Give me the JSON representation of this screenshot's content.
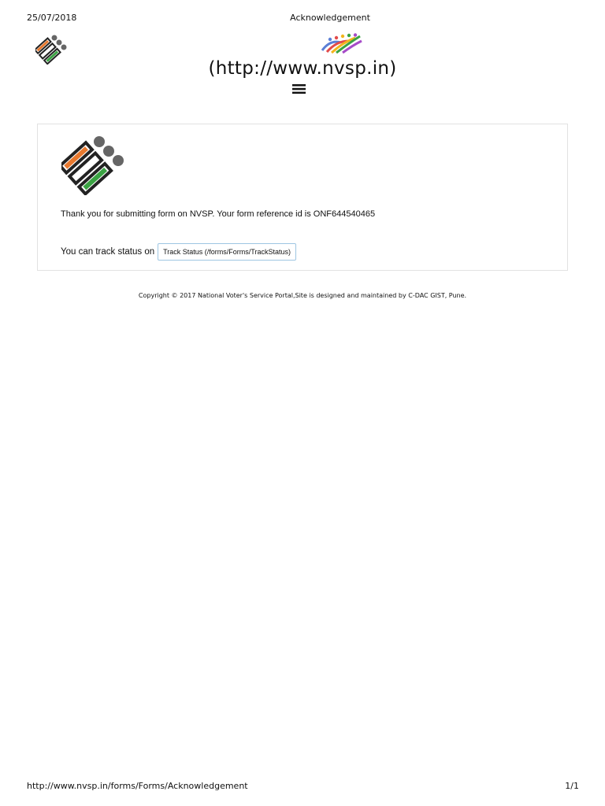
{
  "print_header": {
    "date": "25/07/2018",
    "title": "Acknowledgement"
  },
  "header": {
    "left_logo_icon": "eci-ballot-logo-icon",
    "right_logo_icon": "svp-people-logo-icon",
    "site_link": "(http://www.nvsp.in)",
    "menu_icon": "hamburger-menu-icon"
  },
  "card": {
    "logo_icon": "eci-ballot-logo-icon",
    "thanks_message": "Thank you for submitting form on NVSP. Your form reference id is ONF644540465",
    "track_label": "You can track status on",
    "track_button": "Track Status (/forms/Forms/TrackStatus)"
  },
  "footer": {
    "copyright": "Copyright © 2017 National Voter's Service Portal,Site is designed and maintained by C-DAC GIST, Pune."
  },
  "print_footer": {
    "url": "http://www.nvsp.in/forms/Forms/Acknowledgement",
    "page": "1/1"
  },
  "colors": {
    "saffron": "#e8792f",
    "green": "#3aa343",
    "gray_dot": "#666666",
    "button_border": "#9ec6e2"
  }
}
